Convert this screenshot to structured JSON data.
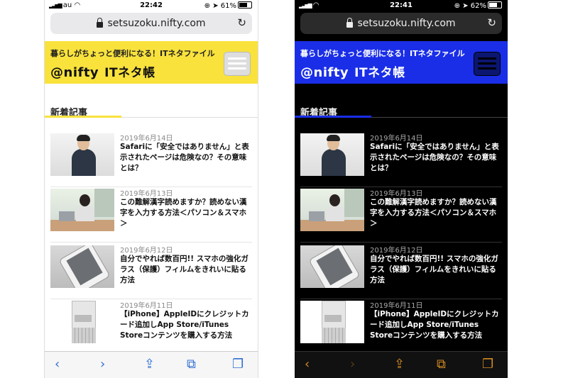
{
  "screens": [
    {
      "status": {
        "carrier": "au",
        "time": "22:42",
        "battery": "61%"
      },
      "url": "setsuzoku.nifty.com",
      "header": {
        "tagline": "暮らしがちょっと便利になる！ITネタファイル",
        "logo": "@nifty",
        "logo_sub": "ITネタ帳"
      },
      "section_title": "新着記事",
      "articles": [
        {
          "date": "2019年6月14日",
          "title": "Safariに「安全ではありません」と表示されたページは危険なの？その意味とは？"
        },
        {
          "date": "2019年6月13日",
          "title": "この難解漢字読めますか？読めない漢字を入力する方法＜パソコン＆スマホ＞"
        },
        {
          "date": "2019年6月12日",
          "title": "自分でやれば数百円!! スマホの強化ガラス（保護）フィルムをきれいに貼る方法"
        },
        {
          "date": "2019年6月11日",
          "title": "【iPhone】AppleIDにクレジットカード追加しApp Store/iTunes Storeコンテンツを購入する方法"
        }
      ],
      "toolbar_icons": [
        "back-icon",
        "forward-icon",
        "share-icon",
        "bookmarks-icon",
        "tabs-icon"
      ],
      "theme": "light"
    },
    {
      "status": {
        "carrier": "",
        "time": "22:41",
        "battery": "62%"
      },
      "url": "setsuzoku.nifty.com",
      "header": {
        "tagline": "暮らしがちょっと便利になる！ITネタファイル",
        "logo": "@nifty",
        "logo_sub": "ITネタ帳"
      },
      "section_title": "新着記事",
      "articles": [
        {
          "date": "2019年6月14日",
          "title": "Safariに「安全ではありません」と表示されたページは危険なの？その意味とは？"
        },
        {
          "date": "2019年6月13日",
          "title": "この難解漢字読めますか？読めない漢字を入力する方法＜パソコン＆スマホ＞"
        },
        {
          "date": "2019年6月12日",
          "title": "自分でやれば数百円!! スマホの強化ガラス（保護）フィルムをきれいに貼る方法"
        },
        {
          "date": "2019年6月11日",
          "title": "【iPhone】AppleIDにクレジットカード追加しApp Store/iTunes Storeコンテンツを購入する方法"
        }
      ],
      "toolbar_icons": [
        "back-icon",
        "forward-icon",
        "share-icon",
        "bookmarks-icon",
        "tabs-icon"
      ],
      "theme": "dark"
    }
  ],
  "colors": {
    "light_header": "#f9e23c",
    "dark_header": "#1a2ee8",
    "light_toolbar_accent": "#2f6fd6",
    "dark_toolbar_accent": "#d38a22"
  }
}
